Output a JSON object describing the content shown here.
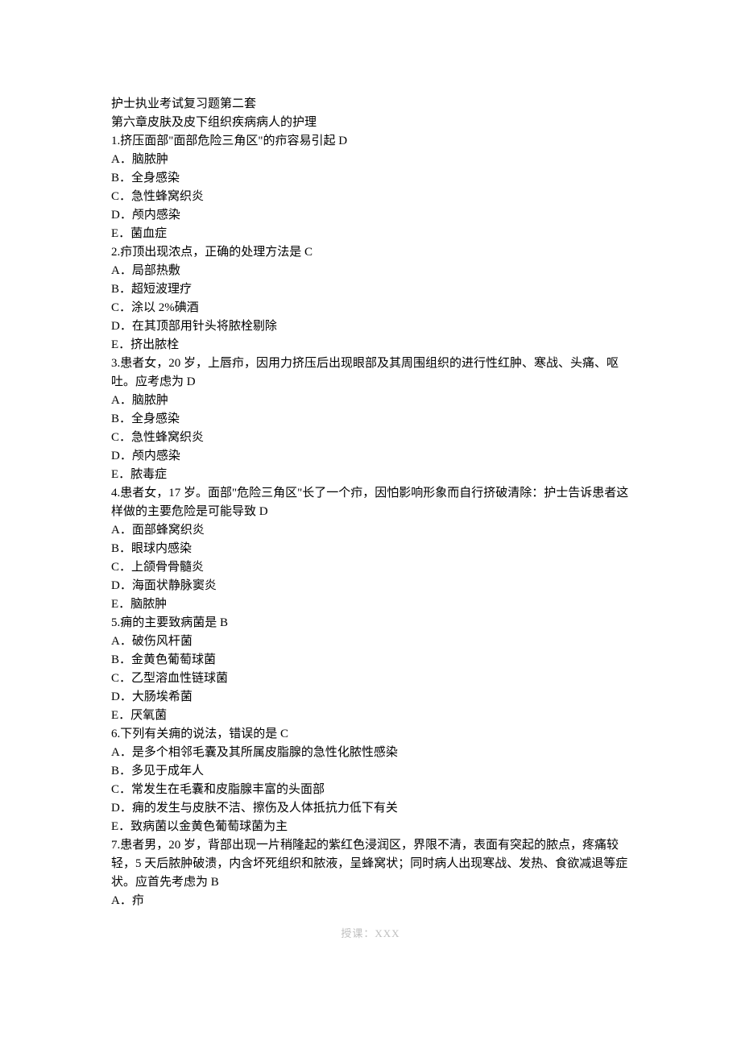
{
  "header": {
    "title": "护士执业考试复习题第二套",
    "chapter": "第六章皮肤及皮下组织疾病病人的护理"
  },
  "questions": [
    {
      "stem": "1.挤压面部\"面部危险三角区\"的疖容易引起 D",
      "options": [
        "A．脑脓肿",
        "B．全身感染",
        "C．急性蜂窝织炎",
        "D．颅内感染",
        "E．菌血症"
      ]
    },
    {
      "stem": "2.疖顶出现浓点，正确的处理方法是 C",
      "options": [
        "A．局部热敷",
        "B．超短波理疗",
        "C．涂以 2%碘酒",
        "D．在其顶部用针头将脓栓剔除",
        "E．挤出脓栓"
      ]
    },
    {
      "stem": "3.患者女，20 岁，上唇疖，因用力挤压后出现眼部及其周围组织的进行性红肿、寒战、头痛、呕吐。应考虑为 D",
      "options": [
        "A．脑脓肿",
        "B．全身感染",
        "C．急性蜂窝织炎",
        "D．颅内感染",
        "E．脓毒症"
      ]
    },
    {
      "stem": "4.患者女，17 岁。面部\"危险三角区\"长了一个疖，因怕影响形象而自行挤破清除：护士告诉患者这样做的主要危险是可能导致 D",
      "options": [
        "A．面部蜂窝织炎",
        "B．眼球内感染",
        "C．上颌骨骨髓炎",
        "D．海面状静脉窦炎",
        "E．脑脓肿"
      ]
    },
    {
      "stem": "5.痈的主要致病菌是 B",
      "options": [
        "A．破伤风杆菌",
        "B．金黄色葡萄球菌",
        "C．乙型溶血性链球菌",
        "D．大肠埃希菌",
        "E．厌氧菌"
      ]
    },
    {
      "stem": "6.下列有关痈的说法，错误的是 C",
      "options": [
        "A．是多个相邻毛囊及其所属皮脂腺的急性化脓性感染",
        "B．多见于成年人",
        "C．常发生在毛囊和皮脂腺丰富的头面部",
        "D．痈的发生与皮肤不洁、擦伤及人体抵抗力低下有关",
        "E．致病菌以金黄色葡萄球菌为主"
      ]
    },
    {
      "stem": "7.患者男，20 岁，背部出现一片稍隆起的紫红色浸润区，界限不清，表面有突起的脓点，疼痛较轻，5 天后脓肿破溃，内含坏死组织和脓液，呈蜂窝状；同时病人出现寒战、发热、食欲减退等症状。应首先考虑为 B",
      "options": [
        "A．疖"
      ]
    }
  ],
  "footer": {
    "text": "授课：XXX"
  }
}
